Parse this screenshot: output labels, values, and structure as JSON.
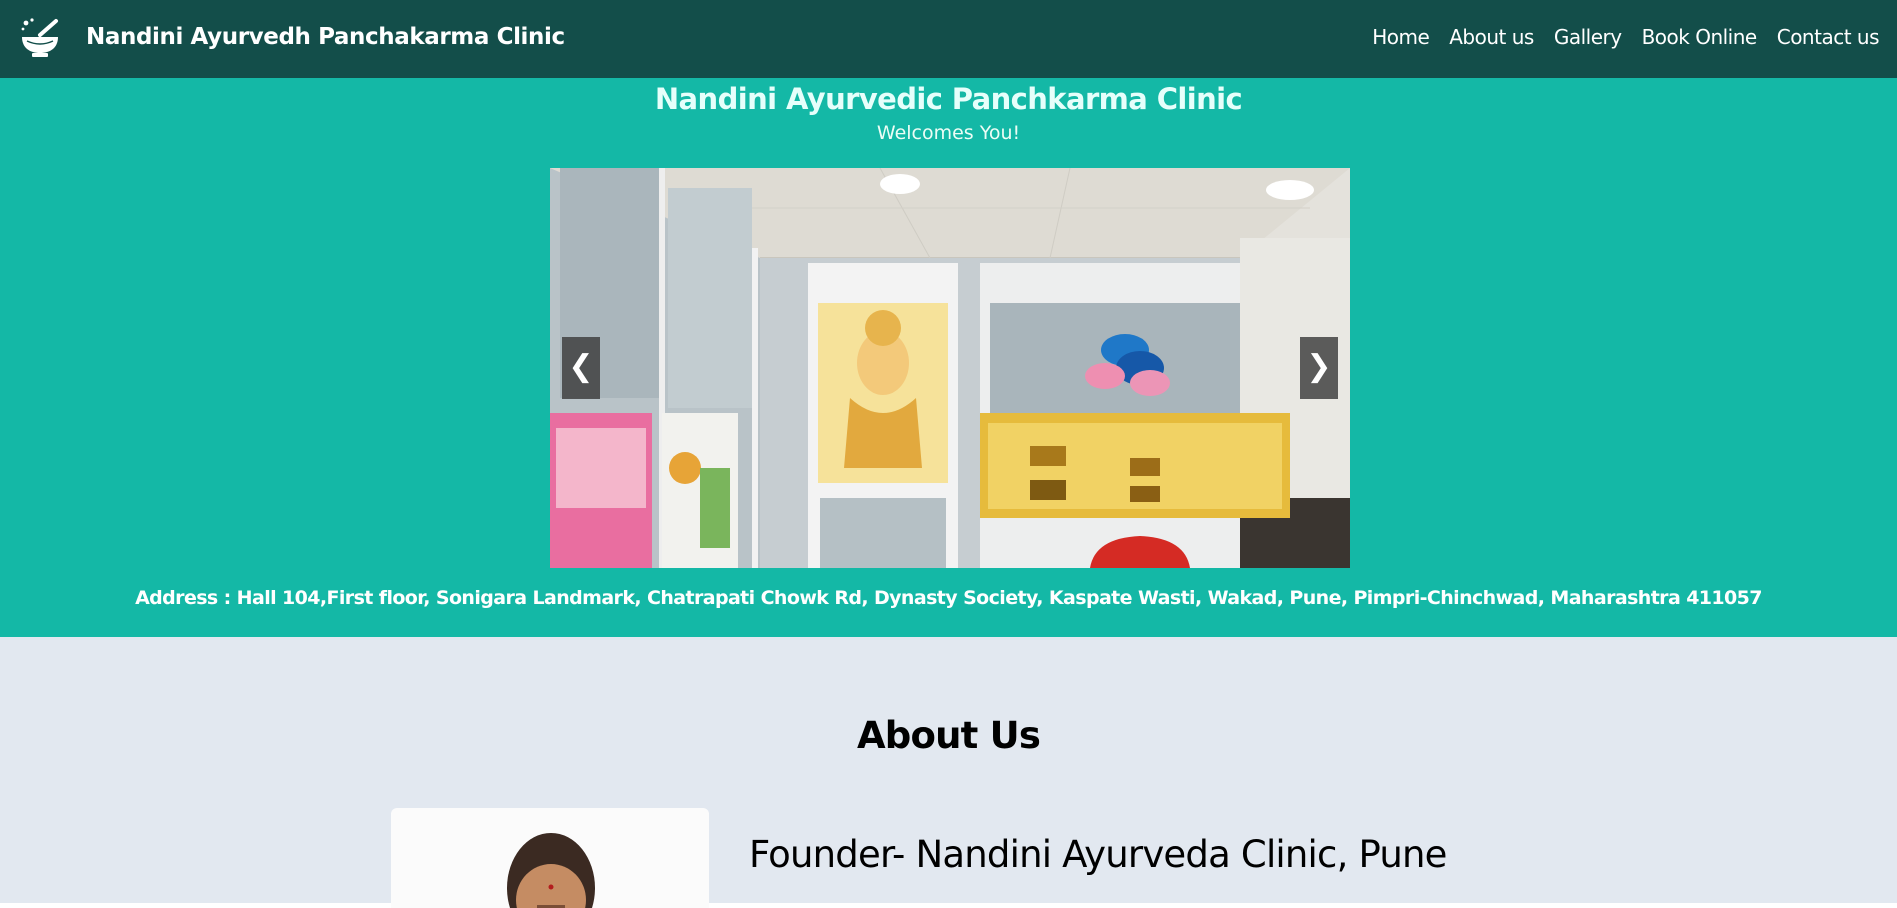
{
  "header": {
    "brand_name": "Nandini Ayurvedh Panchakarma Clinic",
    "logo_icon": "mortar-pestle-icon",
    "nav": [
      {
        "label": "Home"
      },
      {
        "label": "About us"
      },
      {
        "label": "Gallery"
      },
      {
        "label": "Book Online"
      },
      {
        "label": "Contact us"
      }
    ]
  },
  "hero": {
    "title": "Nandini Ayurvedic Panchkarma Clinic",
    "subtitle": "Welcomes You!",
    "carousel": {
      "prev_label": "❮",
      "next_label": "❯"
    },
    "address": "Address : Hall 104,First floor, Sonigara Landmark, Chatrapati Chowk Rd, Dynasty Society, Kaspate Wasti, Wakad, Pune, Pimpri-Chinchwad, Maharashtra 411057"
  },
  "about": {
    "heading": "About Us",
    "founder_title": "Founder- Nandini Ayurveda Clinic, Pune"
  },
  "colors": {
    "navbar": "#134e4a",
    "hero": "#14b8a6",
    "about": "#e2e8f0"
  }
}
